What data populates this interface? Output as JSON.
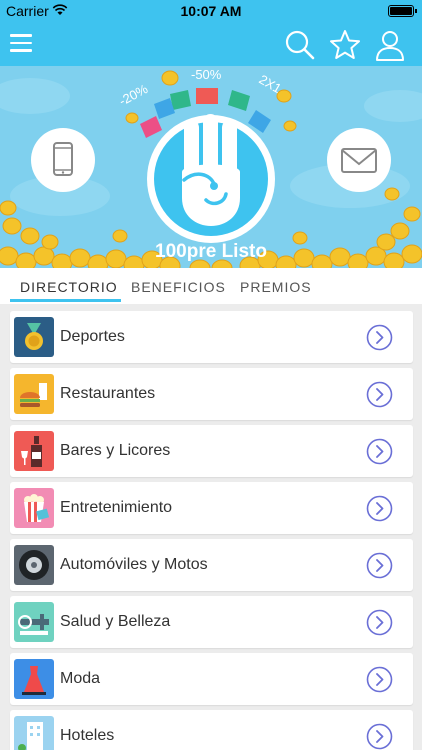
{
  "status_bar": {
    "carrier": "Carrier",
    "time": "10:07 AM"
  },
  "nav": {
    "icons": [
      "menu-icon",
      "search-icon",
      "star-icon",
      "user-icon"
    ]
  },
  "banner": {
    "title": "100pre Listo",
    "tags": [
      "-20%",
      "-50%",
      "2X1"
    ],
    "icons": [
      "phone-icon",
      "mail-icon"
    ]
  },
  "tabs": [
    {
      "label": "DIRECTORIO",
      "active": true
    },
    {
      "label": "BENEFICIOS",
      "active": false
    },
    {
      "label": "PREMIOS",
      "active": false
    }
  ],
  "categories": [
    {
      "label": "Deportes",
      "icon": "medal-icon"
    },
    {
      "label": "Restaurantes",
      "icon": "burger-icon"
    },
    {
      "label": "Bares y Licores",
      "icon": "wine-bottle-icon"
    },
    {
      "label": "Entretenimiento",
      "icon": "popcorn-icon"
    },
    {
      "label": "Automóviles y Motos",
      "icon": "tire-icon"
    },
    {
      "label": "Salud y Belleza",
      "icon": "scale-icon"
    },
    {
      "label": "Moda",
      "icon": "dress-icon"
    },
    {
      "label": "Hoteles",
      "icon": "hotel-icon"
    }
  ],
  "colors": {
    "brand": "#3ec3ef",
    "chevron": "#6a6fd6"
  }
}
